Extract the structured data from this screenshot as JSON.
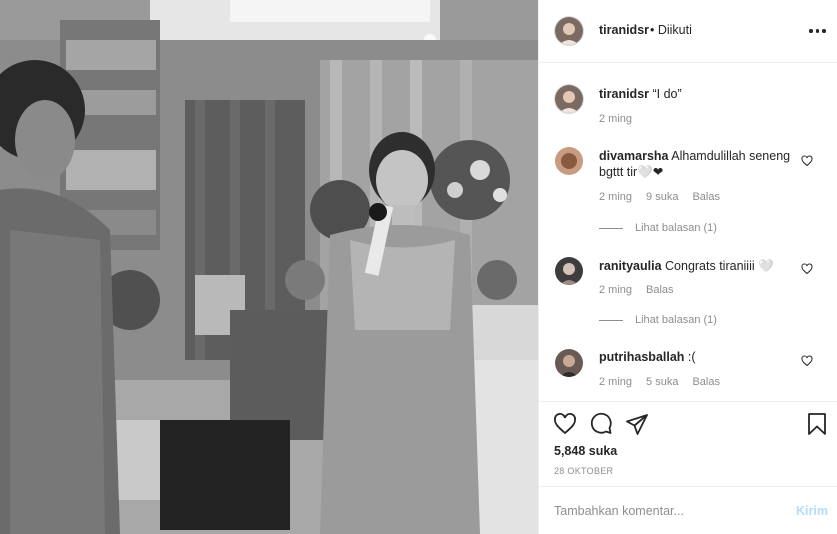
{
  "post": {
    "username": "tiranidsr",
    "follow_status": "• Diikuti",
    "caption_user": "tiranidsr",
    "caption_text": "“I do”",
    "caption_time": "2 ming"
  },
  "comments": [
    {
      "user": "divamarsha",
      "text": "Alhamdulillah seneng bgttt tir🤍❤",
      "time": "2 ming",
      "likes": "9 suka",
      "reply": "Balas",
      "view_replies": "Lihat balasan (1)"
    },
    {
      "user": "ranityaulia",
      "text": "Congrats tiraniiii 🤍",
      "time": "2 ming",
      "reply": "Balas",
      "view_replies": "Lihat balasan (1)"
    },
    {
      "user": "putrihasballah",
      "text": ":(",
      "time": "2 ming",
      "likes": "5 suka",
      "reply": "Balas"
    }
  ],
  "likes_count": "5,848 suka",
  "post_date": "28 OKTOBER",
  "comment_input": {
    "placeholder": "Tambahkan komentar..."
  },
  "post_button": "Kirim",
  "icons": {
    "more": "more-options-icon",
    "like": "heart-icon",
    "comment": "comment-icon",
    "share": "share-icon",
    "save": "bookmark-icon"
  },
  "colors": {
    "text": "#262626",
    "muted": "#8e8e8e",
    "border": "#efefef",
    "post_button_disabled": "#b3dbff"
  }
}
